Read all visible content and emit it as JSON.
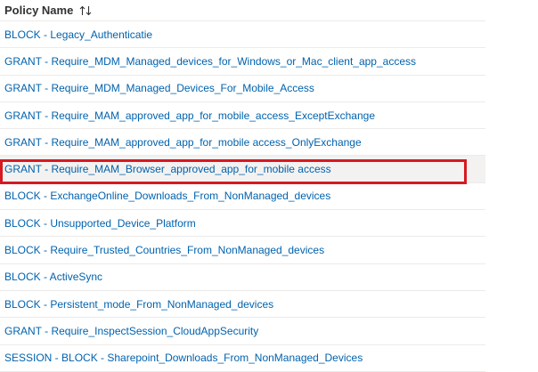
{
  "table": {
    "column_header": "Policy Name",
    "sort_icon": "sort-up-down-icon",
    "selected_index": 5,
    "highlight_color": "#d71920",
    "link_color": "#0062ad",
    "rows": [
      "BLOCK - Legacy_Authenticatie",
      "GRANT - Require_MDM_Managed_devices_for_Windows_or_Mac_client_app_access",
      "GRANT - Require_MDM_Managed_Devices_For_Mobile_Access",
      "GRANT - Require_MAM_approved_app_for_mobile_access_ExceptExchange",
      "GRANT - Require_MAM_approved_app_for_mobile access_OnlyExchange",
      "GRANT - Require_MAM_Browser_approved_app_for_mobile access",
      "BLOCK - ExchangeOnline_Downloads_From_NonManaged_devices",
      "BLOCK - Unsupported_Device_Platform",
      "BLOCK - Require_Trusted_Countries_From_NonManaged_devices",
      "BLOCK - ActiveSync",
      "BLOCK - Persistent_mode_From_NonManaged_devices",
      "GRANT - Require_InspectSession_CloudAppSecurity",
      "SESSION - BLOCK - Sharepoint_Downloads_From_NonManaged_Devices"
    ]
  }
}
